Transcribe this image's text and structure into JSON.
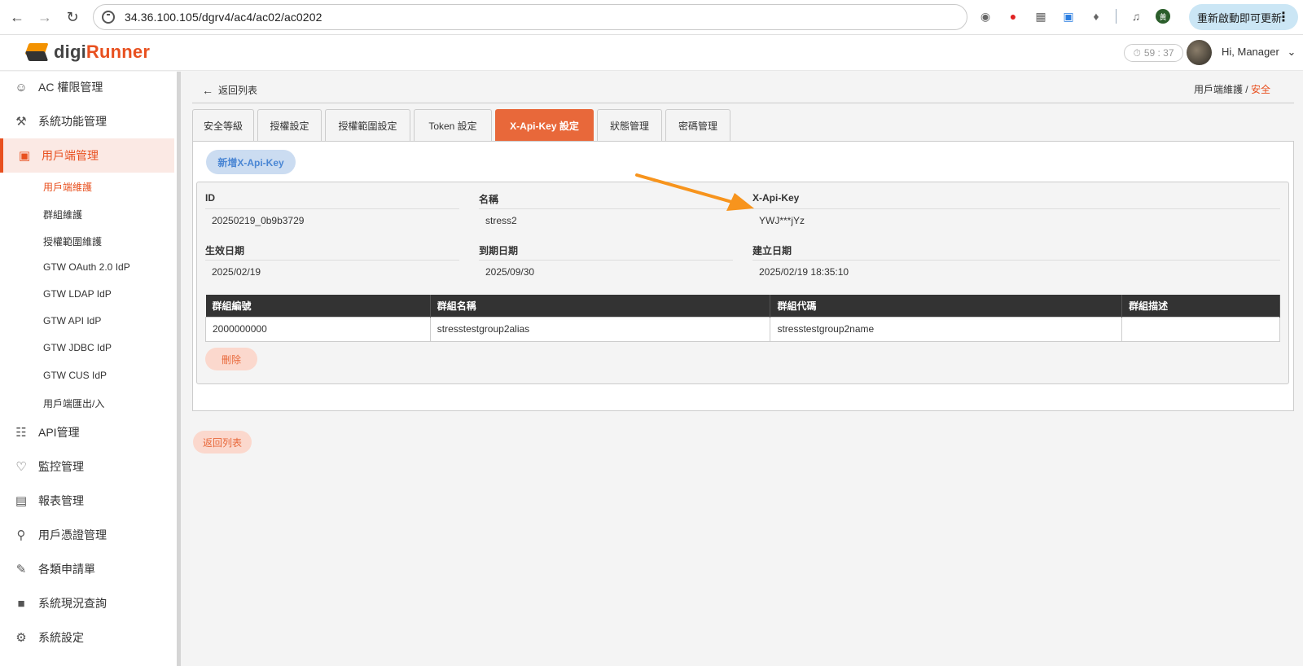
{
  "browser": {
    "url": "34.36.100.105/dgrv4/ac4/ac02/ac0202",
    "update_label": "重新啟動即可更新",
    "profile_initial": "黃"
  },
  "header": {
    "logo_prefix": "digi",
    "logo_suffix": "Runner",
    "timer": "59 : 37",
    "greeting": "Hi, Manager"
  },
  "sidebar": {
    "items": [
      {
        "label": "AC 權限管理",
        "icon": "user-group-icon"
      },
      {
        "label": "系統功能管理",
        "icon": "wrench-icon"
      },
      {
        "label": "用戶端管理",
        "icon": "network-icon"
      },
      {
        "label": "API管理",
        "icon": "api-icon"
      },
      {
        "label": "監控管理",
        "icon": "bell-icon"
      },
      {
        "label": "報表管理",
        "icon": "bar-chart-icon"
      },
      {
        "label": "用戶憑證管理",
        "icon": "search-icon"
      },
      {
        "label": "各類申請單",
        "icon": "edit-icon"
      },
      {
        "label": "系統現況查詢",
        "icon": "lock-icon"
      },
      {
        "label": "系統設定",
        "icon": "gear-icon"
      }
    ],
    "sub_items": [
      "用戶端維護",
      "群組維護",
      "授權範圍維護",
      "GTW OAuth 2.0 IdP",
      "GTW LDAP IdP",
      "GTW API IdP",
      "GTW JDBC IdP",
      "GTW CUS IdP",
      "用戶端匯出/入"
    ]
  },
  "main": {
    "back_label": "返回列表",
    "breadcrumb_parent": "用戶端維護",
    "breadcrumb_sep": " / ",
    "breadcrumb_current": "安全",
    "tabs": [
      "安全等級",
      "授權設定",
      "授權範圍設定",
      "Token 設定",
      "X-Api-Key 設定",
      "狀態管理",
      "密碼管理"
    ],
    "add_button": "新增X-Api-Key",
    "fields": {
      "id_label": "ID",
      "id_value": "20250219_0b9b3729",
      "name_label": "名稱",
      "name_value": "stress2",
      "key_label": "X-Api-Key",
      "key_value": "YWJ***jYz",
      "effective_label": "生效日期",
      "effective_value": "2025/02/19",
      "expire_label": "到期日期",
      "expire_value": "2025/09/30",
      "created_label": "建立日期",
      "created_value": "2025/02/19 18:35:10"
    },
    "table": {
      "headers": [
        "群組編號",
        "群組名稱",
        "群組代碼",
        "群組描述"
      ],
      "rows": [
        [
          "2000000000",
          "stresstestgroup2alias",
          "stresstestgroup2name",
          ""
        ]
      ]
    },
    "delete_button": "刪除",
    "return_button": "返回列表"
  },
  "colors": {
    "accent": "#e8683a",
    "brand_orange": "#e8501f",
    "annotation_arrow": "#f7941d"
  }
}
